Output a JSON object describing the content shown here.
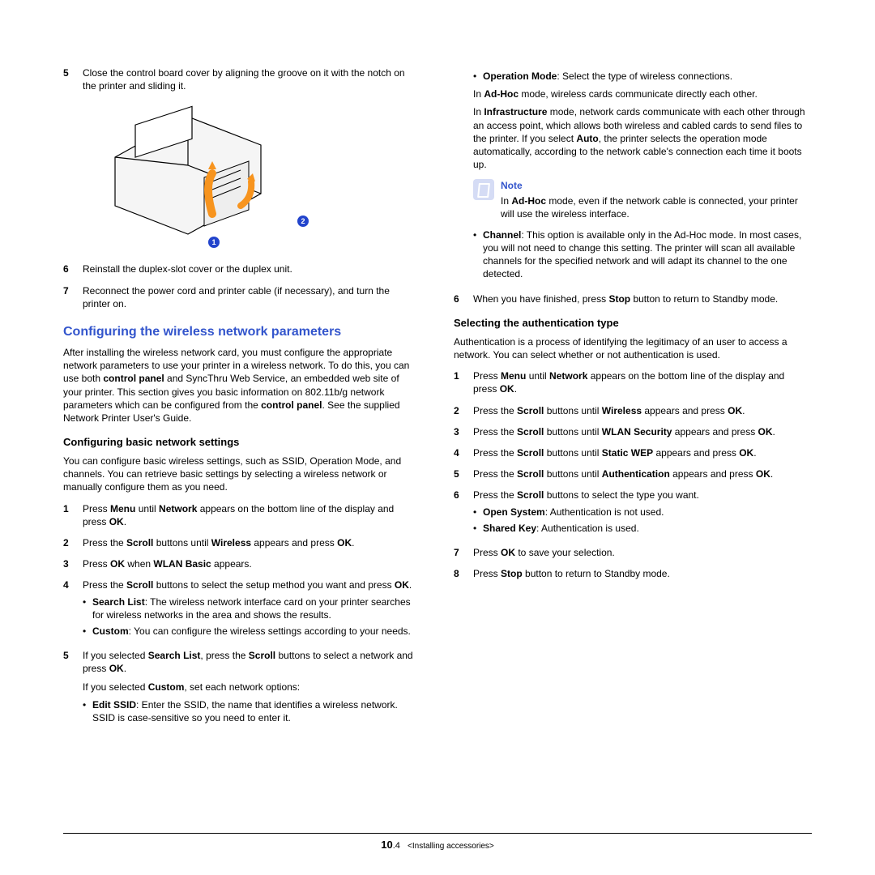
{
  "left": {
    "s5": "Close the control board cover by aligning the groove on it with the notch on the printer and sliding it.",
    "c1": "1",
    "c2": "2",
    "s6": "Reinstall the duplex-slot cover or the duplex unit.",
    "s7": "Reconnect the power cord and printer cable (if necessary), and turn the printer on.",
    "h1": "Configuring the wireless network parameters",
    "intro1": "After installing the wireless network card, you must configure the appropriate network parameters to use your printer in a wireless network. To do this, you can use both ",
    "intro_b1": "control panel",
    "intro2": " and SyncThru Web Service, an embedded web site of your printer. This section gives you basic information on 802.11b/g network parameters which can be configured from the ",
    "intro_b2": "control panel",
    "intro3": ". See the supplied Network Printer User's Guide.",
    "h2a": "Configuring basic network settings",
    "basicIntro": "You can configure basic wireless settings, such as SSID, Operation Mode, and channels. You can retrieve basic settings by selecting a wireless network or manually configure them as you need.",
    "b1a": "Press ",
    "b1b": "Menu",
    "b1c": " until ",
    "b1d": "Network",
    "b1e": " appears on the bottom line of the display and press ",
    "b1f": "OK",
    "b1g": ".",
    "b2a": "Press the ",
    "b2b": "Scroll",
    "b2c": " buttons until ",
    "b2d": "Wireless",
    "b2e": " appears and press ",
    "b2f": "OK",
    "b2g": ".",
    "b3a": "Press ",
    "b3b": "OK",
    "b3c": " when ",
    "b3d": "WLAN Basic",
    "b3e": " appears.",
    "b4a": "Press the ",
    "b4b": "Scroll",
    "b4c": " buttons to select the setup method you want and press ",
    "b4d": "OK",
    "b4e": ".",
    "b4s1a": "Search List",
    "b4s1b": ": The wireless network interface card on your printer searches for wireless networks in the area and shows the results.",
    "b4s2a": "Custom",
    "b4s2b": ": You can configure the wireless settings according to your needs.",
    "b5a": "If you selected ",
    "b5b": "Search List",
    "b5c": ", press the ",
    "b5d": "Scroll",
    "b5e": " buttons to select a network and press ",
    "b5f": "OK",
    "b5g": ".",
    "b5line2a": "If you selected ",
    "b5line2b": "Custom",
    "b5line2c": ", set each network options:",
    "b5s1a": "Edit SSID",
    "b5s1b": ": Enter the SSID, the name that identifies a wireless network. SSID is case-sensitive so you need to enter it."
  },
  "right": {
    "r_opa": "Operation Mode",
    "r_opb": ": Select the type of wireless connections.",
    "r_ad1a": "In ",
    "r_ad1b": "Ad-Hoc",
    "r_ad1c": " mode, wireless cards communicate directly each other.",
    "r_inf1a": "In ",
    "r_inf1b": "Infrastructure",
    "r_inf1c": " mode, network cards communicate with each other through an access point, which allows both wireless and cabled cards to send files to the printer. If you select ",
    "r_inf1d": "Auto",
    "r_inf1e": ", the printer selects the operation mode automatically, according to the network cable's connection each time it boots up.",
    "noteTitle": "Note",
    "note1a": "In ",
    "note1b": "Ad-Hoc",
    "note1c": " mode, even if the network cable is connected, your printer will use the wireless interface.",
    "r_cha": "Channel",
    "r_chb": ": This option is available only in the Ad-Hoc mode. In most cases, you will not need to change this setting. The printer will scan all available channels for the specified network and will adapt its channel to the one detected.",
    "r6a": "When you have finished, press ",
    "r6b": "Stop",
    "r6c": " button to return to Standby mode.",
    "h2b": "Selecting the authentication type",
    "authIntro": "Authentication is a process of identifying the legitimacy of an user to access a network. You can select whether or not authentication is used.",
    "a1a": "Press ",
    "a1b": "Menu",
    "a1c": " until ",
    "a1d": "Network",
    "a1e": " appears on the bottom line of the display and press ",
    "a1f": "OK",
    "a1g": ".",
    "a2a": "Press the ",
    "a2b": "Scroll",
    "a2c": " buttons until ",
    "a2d": "Wireless",
    "a2e": " appears and press ",
    "a2f": "OK",
    "a2g": ".",
    "a3a": "Press the ",
    "a3b": "Scroll",
    "a3c": " buttons until ",
    "a3d": "WLAN Security",
    "a3e": " appears and press ",
    "a3f": "OK",
    "a3g": ".",
    "a4a": "Press the ",
    "a4b": "Scroll",
    "a4c": " buttons until ",
    "a4d": "Static WEP",
    "a4e": " appears and press ",
    "a4f": "OK",
    "a4g": ".",
    "a5a": "Press the ",
    "a5b": "Scroll",
    "a5c": " buttons until ",
    "a5d": "Authentication",
    "a5e": " appears and press ",
    "a5f": "OK",
    "a5g": ".",
    "a6a": "Press the ",
    "a6b": "Scroll",
    "a6c": " buttons to select the type you want.",
    "a6s1a": "Open System",
    "a6s1b": ": Authentication is not used.",
    "a6s2a": "Shared Key",
    "a6s2b": ": Authentication is used.",
    "a7a": "Press ",
    "a7b": "OK",
    "a7c": " to save your selection.",
    "a8a": "Press ",
    "a8b": "Stop",
    "a8c": " button to return to Standby mode."
  },
  "footer": {
    "chapter": "10",
    "page": ".4",
    "section": "<Installing accessories>"
  }
}
